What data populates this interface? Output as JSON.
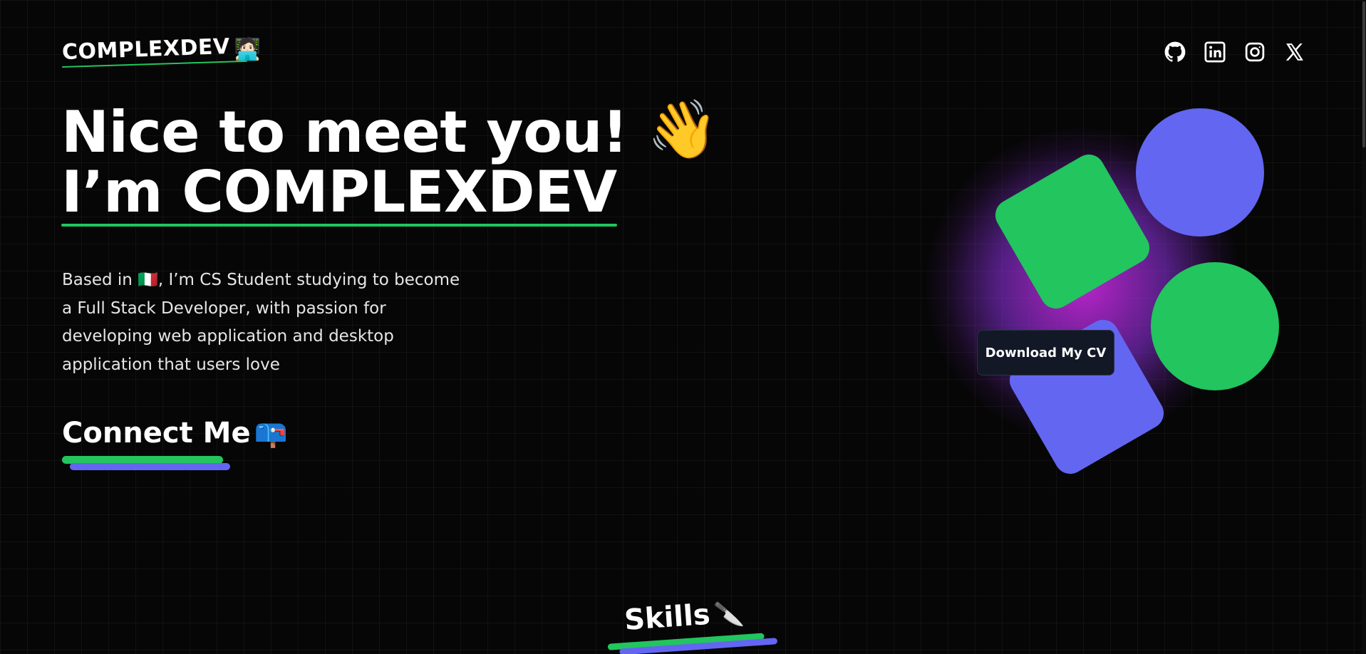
{
  "header": {
    "logo_text": "COMPLEXDEV",
    "logo_emoji": "🧑🏻‍💻",
    "socials": [
      {
        "name": "github",
        "icon": "github-icon"
      },
      {
        "name": "linkedin",
        "icon": "linkedin-icon"
      },
      {
        "name": "instagram",
        "icon": "instagram-icon"
      },
      {
        "name": "x",
        "icon": "x-icon"
      }
    ]
  },
  "hero": {
    "line1": "Nice to meet you!",
    "wave_emoji": "👋",
    "line2": "I’m COMPLEXDEV",
    "bio": "Based in 🇮🇹, I’m CS Student studying to become a Full Stack Developer, with passion for developing web application and desktop application that users love",
    "connect_label": "Connect Me",
    "connect_emoji": "📪"
  },
  "cta": {
    "download_cv": "Download My CV"
  },
  "skills": {
    "title": "Skills",
    "emoji": "🔪"
  },
  "colors": {
    "accent_green": "#22c55e",
    "accent_blue": "#6366f1",
    "glow": "#c026d3",
    "background": "#060606"
  }
}
